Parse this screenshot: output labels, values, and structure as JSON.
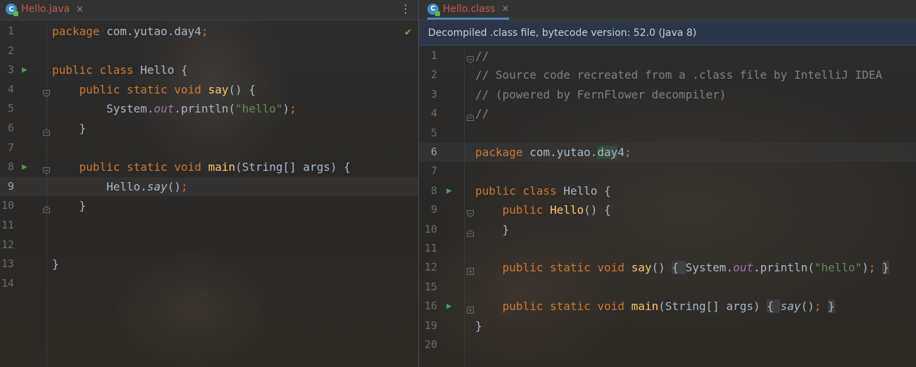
{
  "left_tab": {
    "label": "Hello.java",
    "close": "×",
    "icon_letter": "C"
  },
  "right_tab": {
    "label": "Hello.class",
    "close": "×",
    "icon_letter": "C"
  },
  "menu_icon": "⋮",
  "status_check": "✔",
  "banner": {
    "text": "Decompiled .class file, bytecode version: 52.0 (Java 8)"
  },
  "left_lines": [
    {
      "num": "1",
      "seg": [
        {
          "t": "package ",
          "c": "kw"
        },
        {
          "t": "com.yutao.day4"
        },
        {
          "t": ";",
          "c": "kw"
        }
      ]
    },
    {
      "num": "2",
      "seg": []
    },
    {
      "num": "3",
      "run": true,
      "seg": [
        {
          "t": "public class ",
          "c": "kw"
        },
        {
          "t": "Hello {"
        }
      ]
    },
    {
      "num": "4",
      "fold": "start",
      "seg": [
        {
          "t": "    public static void ",
          "c": "kw"
        },
        {
          "t": "say",
          "c": "fn"
        },
        {
          "t": "() {"
        }
      ]
    },
    {
      "num": "5",
      "seg": [
        {
          "t": "        System."
        },
        {
          "t": "out",
          "c": "st"
        },
        {
          "t": ".println("
        },
        {
          "t": "\"hello\"",
          "c": "str"
        },
        {
          "t": ")"
        },
        {
          "t": ";",
          "c": "kw"
        }
      ]
    },
    {
      "num": "6",
      "fold": "end",
      "seg": [
        {
          "t": "    }"
        }
      ]
    },
    {
      "num": "7",
      "seg": []
    },
    {
      "num": "8",
      "run": true,
      "fold": "start",
      "seg": [
        {
          "t": "    public static void ",
          "c": "kw"
        },
        {
          "t": "main",
          "c": "fn"
        },
        {
          "t": "(String[] args) {"
        }
      ]
    },
    {
      "num": "9",
      "cur": true,
      "seg": [
        {
          "t": "        Hello."
        },
        {
          "t": "say",
          "c": "it"
        },
        {
          "t": "()"
        },
        {
          "t": ";",
          "c": "kw"
        }
      ]
    },
    {
      "num": "10",
      "fold": "end",
      "seg": [
        {
          "t": "    }"
        }
      ]
    },
    {
      "num": "11",
      "seg": []
    },
    {
      "num": "12",
      "seg": []
    },
    {
      "num": "13",
      "seg": [
        {
          "t": "}"
        }
      ]
    },
    {
      "num": "14",
      "seg": []
    }
  ],
  "right_lines": [
    {
      "num": "1",
      "fold": "start",
      "seg": [
        {
          "t": "//",
          "c": "cm"
        }
      ]
    },
    {
      "num": "2",
      "seg": [
        {
          "t": "// Source code recreated from a .class file by IntelliJ IDEA",
          "c": "cm"
        }
      ]
    },
    {
      "num": "3",
      "seg": [
        {
          "t": "// (powered by FernFlower decompiler)",
          "c": "cm"
        }
      ]
    },
    {
      "num": "4",
      "fold": "end",
      "seg": [
        {
          "t": "//",
          "c": "cm"
        }
      ]
    },
    {
      "num": "5",
      "seg": []
    },
    {
      "num": "6",
      "cur": true,
      "seg": [
        {
          "t": "package ",
          "c": "kw"
        },
        {
          "t": "com.yutao."
        },
        {
          "t": "da",
          "c": "sel"
        },
        {
          "t": "",
          "caret": true
        },
        {
          "t": "y",
          "c": "sel"
        },
        {
          "t": "4"
        },
        {
          "t": ";",
          "c": "kw"
        }
      ]
    },
    {
      "num": "7",
      "seg": []
    },
    {
      "num": "8",
      "run": true,
      "seg": [
        {
          "t": "public class ",
          "c": "kw"
        },
        {
          "t": "Hello {"
        }
      ]
    },
    {
      "num": "9",
      "fold": "start",
      "seg": [
        {
          "t": "    public ",
          "c": "kw"
        },
        {
          "t": "Hello",
          "c": "fn"
        },
        {
          "t": "() {"
        }
      ]
    },
    {
      "num": "10",
      "fold": "end",
      "seg": [
        {
          "t": "    }"
        }
      ]
    },
    {
      "num": "11",
      "seg": []
    },
    {
      "num": "12",
      "fold": "plus",
      "seg": [
        {
          "t": "    public static void ",
          "c": "kw"
        },
        {
          "t": "say",
          "c": "fn"
        },
        {
          "t": "() "
        },
        {
          "t": "{ ",
          "c": "fb"
        },
        {
          "t": "System."
        },
        {
          "t": "out",
          "c": "st"
        },
        {
          "t": ".println("
        },
        {
          "t": "\"hello\"",
          "c": "str"
        },
        {
          "t": ")"
        },
        {
          "t": "; ",
          "c": "kw"
        },
        {
          "t": "}",
          "c": "fb"
        }
      ]
    },
    {
      "num": "15",
      "seg": []
    },
    {
      "num": "16",
      "run": true,
      "fold": "plus",
      "seg": [
        {
          "t": "    public static void ",
          "c": "kw"
        },
        {
          "t": "main",
          "c": "fn"
        },
        {
          "t": "(String[] args) "
        },
        {
          "t": "{ ",
          "c": "fb"
        },
        {
          "t": "say",
          "c": "it"
        },
        {
          "t": "()"
        },
        {
          "t": "; ",
          "c": "kw"
        },
        {
          "t": "}",
          "c": "fb"
        }
      ]
    },
    {
      "num": "19",
      "seg": [
        {
          "t": "}"
        }
      ]
    },
    {
      "num": "20",
      "seg": []
    }
  ]
}
